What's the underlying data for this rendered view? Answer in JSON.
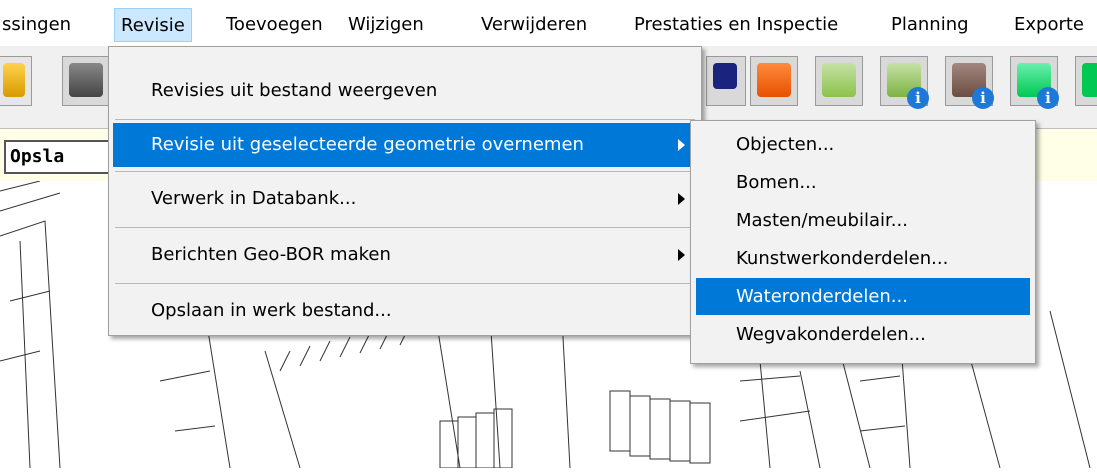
{
  "menubar": {
    "items": [
      {
        "label": "ssingen"
      },
      {
        "label": "Revisie"
      },
      {
        "label": "Toevoegen"
      },
      {
        "label": "Wijzigen"
      },
      {
        "label": "Verwijderen"
      },
      {
        "label": "Prestaties en Inspectie"
      },
      {
        "label": "Planning"
      },
      {
        "label": "Exporte"
      }
    ],
    "active": "Revisie"
  },
  "toolbar": {
    "icons": [
      "print-icon",
      "plotter-icon",
      "monitor-icon",
      "house-icon",
      "folder-icon",
      "folder-info-icon",
      "tools-info-icon",
      "green-info-icon"
    ]
  },
  "status": {
    "field_value": "Opsla"
  },
  "revisie_menu": {
    "items": [
      {
        "label": "Revisies uit bestand weergeven",
        "has_submenu": false
      },
      {
        "label": "Revisie uit geselecteerde geometrie overnemen",
        "has_submenu": true,
        "highlighted": true
      },
      {
        "label": "Verwerk in Databank...",
        "has_submenu": true
      },
      {
        "label": "Berichten Geo-BOR maken",
        "has_submenu": true
      },
      {
        "label": "Opslaan in werk bestand...",
        "has_submenu": false
      }
    ]
  },
  "submenu": {
    "items": [
      {
        "label": "Objecten..."
      },
      {
        "label": "Bomen..."
      },
      {
        "label": "Masten/meubilair..."
      },
      {
        "label": "Kunstwerkonderdelen..."
      },
      {
        "label": "Wateronderdelen...",
        "highlighted": true
      },
      {
        "label": "Wegvakonderdelen..."
      }
    ]
  },
  "colors": {
    "highlight": "#0078d7",
    "menubar_active": "#cce8ff",
    "status_strip": "#ffffe8"
  }
}
